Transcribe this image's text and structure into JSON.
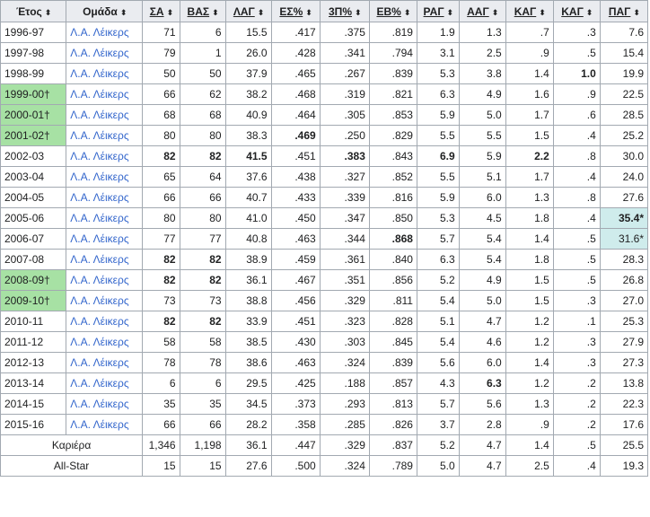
{
  "columns": [
    {
      "key": "year",
      "label": "Έτος",
      "underline": false,
      "align": "left"
    },
    {
      "key": "team",
      "label": "Ομάδα",
      "underline": false,
      "align": "left"
    },
    {
      "key": "gp",
      "label": "ΣΑ",
      "underline": true,
      "align": "right"
    },
    {
      "key": "gs",
      "label": "ΒΑΣ",
      "underline": true,
      "align": "right"
    },
    {
      "key": "mpg",
      "label": "ΛΑΓ",
      "underline": true,
      "align": "right"
    },
    {
      "key": "fg",
      "label": "ΕΣ%",
      "underline": true,
      "align": "right"
    },
    {
      "key": "p3",
      "label": "3Π%",
      "underline": true,
      "align": "right"
    },
    {
      "key": "ft",
      "label": "ΕΒ%",
      "underline": true,
      "align": "right"
    },
    {
      "key": "rpg",
      "label": "ΡΑΓ",
      "underline": true,
      "align": "right"
    },
    {
      "key": "apg",
      "label": "ΑΑΓ",
      "underline": true,
      "align": "right"
    },
    {
      "key": "spg",
      "label": "ΚΑΓ",
      "underline": true,
      "align": "right"
    },
    {
      "key": "bpg",
      "label": "ΚΑΓ",
      "underline": true,
      "align": "right"
    },
    {
      "key": "ppg",
      "label": "ΠΑΓ",
      "underline": true,
      "align": "right"
    }
  ],
  "sort_icon": "⬍",
  "rows": [
    {
      "year": "1996-97",
      "team": "Λ.Α. Λέικερς",
      "gp": "71",
      "gs": "6",
      "mpg": "15.5",
      "fg": ".417",
      "p3": ".375",
      "ft": ".819",
      "rpg": "1.9",
      "apg": "1.3",
      "spg": ".7",
      "bpg": ".3",
      "ppg": "7.6"
    },
    {
      "year": "1997-98",
      "team": "Λ.Α. Λέικερς",
      "gp": "79",
      "gs": "1",
      "mpg": "26.0",
      "fg": ".428",
      "p3": ".341",
      "ft": ".794",
      "rpg": "3.1",
      "apg": "2.5",
      "spg": ".9",
      "bpg": ".5",
      "ppg": "15.4"
    },
    {
      "year": "1998-99",
      "team": "Λ.Α. Λέικερς",
      "gp": "50",
      "gs": "50",
      "mpg": "37.9",
      "fg": ".465",
      "p3": ".267",
      "ft": ".839",
      "rpg": "5.3",
      "apg": "3.8",
      "spg": "1.4",
      "bpg": "1.0",
      "ppg": "19.9",
      "bold": [
        "bpg"
      ]
    },
    {
      "year": "1999-00†",
      "team": "Λ.Α. Λέικερς",
      "gp": "66",
      "gs": "62",
      "mpg": "38.2",
      "fg": ".468",
      "p3": ".319",
      "ft": ".821",
      "rpg": "6.3",
      "apg": "4.9",
      "spg": "1.6",
      "bpg": ".9",
      "ppg": "22.5",
      "champion": true
    },
    {
      "year": "2000-01†",
      "team": "Λ.Α. Λέικερς",
      "gp": "68",
      "gs": "68",
      "mpg": "40.9",
      "fg": ".464",
      "p3": ".305",
      "ft": ".853",
      "rpg": "5.9",
      "apg": "5.0",
      "spg": "1.7",
      "bpg": ".6",
      "ppg": "28.5",
      "champion": true
    },
    {
      "year": "2001-02†",
      "team": "Λ.Α. Λέικερς",
      "gp": "80",
      "gs": "80",
      "mpg": "38.3",
      "fg": ".469",
      "p3": ".250",
      "ft": ".829",
      "rpg": "5.5",
      "apg": "5.5",
      "spg": "1.5",
      "bpg": ".4",
      "ppg": "25.2",
      "champion": true,
      "bold": [
        "fg"
      ]
    },
    {
      "year": "2002-03",
      "team": "Λ.Α. Λέικερς",
      "gp": "82",
      "gs": "82",
      "mpg": "41.5",
      "fg": ".451",
      "p3": ".383",
      "ft": ".843",
      "rpg": "6.9",
      "apg": "5.9",
      "spg": "2.2",
      "bpg": ".8",
      "ppg": "30.0",
      "bold": [
        "gp",
        "gs",
        "mpg",
        "p3",
        "rpg",
        "spg"
      ]
    },
    {
      "year": "2003-04",
      "team": "Λ.Α. Λέικερς",
      "gp": "65",
      "gs": "64",
      "mpg": "37.6",
      "fg": ".438",
      "p3": ".327",
      "ft": ".852",
      "rpg": "5.5",
      "apg": "5.1",
      "spg": "1.7",
      "bpg": ".4",
      "ppg": "24.0"
    },
    {
      "year": "2004-05",
      "team": "Λ.Α. Λέικερς",
      "gp": "66",
      "gs": "66",
      "mpg": "40.7",
      "fg": ".433",
      "p3": ".339",
      "ft": ".816",
      "rpg": "5.9",
      "apg": "6.0",
      "spg": "1.3",
      "bpg": ".8",
      "ppg": "27.6"
    },
    {
      "year": "2005-06",
      "team": "Λ.Α. Λέικερς",
      "gp": "80",
      "gs": "80",
      "mpg": "41.0",
      "fg": ".450",
      "p3": ".347",
      "ft": ".850",
      "rpg": "5.3",
      "apg": "4.5",
      "spg": "1.8",
      "bpg": ".4",
      "ppg": "35.4*",
      "bold": [
        "ppg"
      ],
      "lead": [
        "ppg"
      ]
    },
    {
      "year": "2006-07",
      "team": "Λ.Α. Λέικερς",
      "gp": "77",
      "gs": "77",
      "mpg": "40.8",
      "fg": ".463",
      "p3": ".344",
      "ft": ".868",
      "rpg": "5.7",
      "apg": "5.4",
      "spg": "1.4",
      "bpg": ".5",
      "ppg": "31.6*",
      "bold": [
        "ft"
      ],
      "lead": [
        "ppg"
      ]
    },
    {
      "year": "2007-08",
      "team": "Λ.Α. Λέικερς",
      "gp": "82",
      "gs": "82",
      "mpg": "38.9",
      "fg": ".459",
      "p3": ".361",
      "ft": ".840",
      "rpg": "6.3",
      "apg": "5.4",
      "spg": "1.8",
      "bpg": ".5",
      "ppg": "28.3",
      "bold": [
        "gp",
        "gs"
      ]
    },
    {
      "year": "2008-09†",
      "team": "Λ.Α. Λέικερς",
      "gp": "82",
      "gs": "82",
      "mpg": "36.1",
      "fg": ".467",
      "p3": ".351",
      "ft": ".856",
      "rpg": "5.2",
      "apg": "4.9",
      "spg": "1.5",
      "bpg": ".5",
      "ppg": "26.8",
      "champion": true,
      "bold": [
        "gp",
        "gs"
      ]
    },
    {
      "year": "2009-10†",
      "team": "Λ.Α. Λέικερς",
      "gp": "73",
      "gs": "73",
      "mpg": "38.8",
      "fg": ".456",
      "p3": ".329",
      "ft": ".811",
      "rpg": "5.4",
      "apg": "5.0",
      "spg": "1.5",
      "bpg": ".3",
      "ppg": "27.0",
      "champion": true
    },
    {
      "year": "2010-11",
      "team": "Λ.Α. Λέικερς",
      "gp": "82",
      "gs": "82",
      "mpg": "33.9",
      "fg": ".451",
      "p3": ".323",
      "ft": ".828",
      "rpg": "5.1",
      "apg": "4.7",
      "spg": "1.2",
      "bpg": ".1",
      "ppg": "25.3",
      "bold": [
        "gp",
        "gs"
      ]
    },
    {
      "year": "2011-12",
      "team": "Λ.Α. Λέικερς",
      "gp": "58",
      "gs": "58",
      "mpg": "38.5",
      "fg": ".430",
      "p3": ".303",
      "ft": ".845",
      "rpg": "5.4",
      "apg": "4.6",
      "spg": "1.2",
      "bpg": ".3",
      "ppg": "27.9"
    },
    {
      "year": "2012-13",
      "team": "Λ.Α. Λέικερς",
      "gp": "78",
      "gs": "78",
      "mpg": "38.6",
      "fg": ".463",
      "p3": ".324",
      "ft": ".839",
      "rpg": "5.6",
      "apg": "6.0",
      "spg": "1.4",
      "bpg": ".3",
      "ppg": "27.3"
    },
    {
      "year": "2013-14",
      "team": "Λ.Α. Λέικερς",
      "gp": "6",
      "gs": "6",
      "mpg": "29.5",
      "fg": ".425",
      "p3": ".188",
      "ft": ".857",
      "rpg": "4.3",
      "apg": "6.3",
      "spg": "1.2",
      "bpg": ".2",
      "ppg": "13.8",
      "bold": [
        "apg"
      ]
    },
    {
      "year": "2014-15",
      "team": "Λ.Α. Λέικερς",
      "gp": "35",
      "gs": "35",
      "mpg": "34.5",
      "fg": ".373",
      "p3": ".293",
      "ft": ".813",
      "rpg": "5.7",
      "apg": "5.6",
      "spg": "1.3",
      "bpg": ".2",
      "ppg": "22.3"
    },
    {
      "year": "2015-16",
      "team": "Λ.Α. Λέικερς",
      "gp": "66",
      "gs": "66",
      "mpg": "28.2",
      "fg": ".358",
      "p3": ".285",
      "ft": ".826",
      "rpg": "3.7",
      "apg": "2.8",
      "spg": ".9",
      "bpg": ".2",
      "ppg": "17.6"
    }
  ],
  "totals": [
    {
      "label": "Καριέρα",
      "gp": "1,346",
      "gs": "1,198",
      "mpg": "36.1",
      "fg": ".447",
      "p3": ".329",
      "ft": ".837",
      "rpg": "5.2",
      "apg": "4.7",
      "spg": "1.4",
      "bpg": ".5",
      "ppg": "25.5"
    },
    {
      "label": "All-Star",
      "gp": "15",
      "gs": "15",
      "mpg": "27.6",
      "fg": ".500",
      "p3": ".324",
      "ft": ".789",
      "rpg": "5.0",
      "apg": "4.7",
      "spg": "2.5",
      "bpg": ".4",
      "ppg": "19.3"
    }
  ],
  "colors": {
    "header_bg": "#eaecf0",
    "border": "#a2a9b1",
    "link": "#3366cc",
    "champion_bg": "#a7e1a4",
    "league_lead_bg": "#cfecec"
  }
}
